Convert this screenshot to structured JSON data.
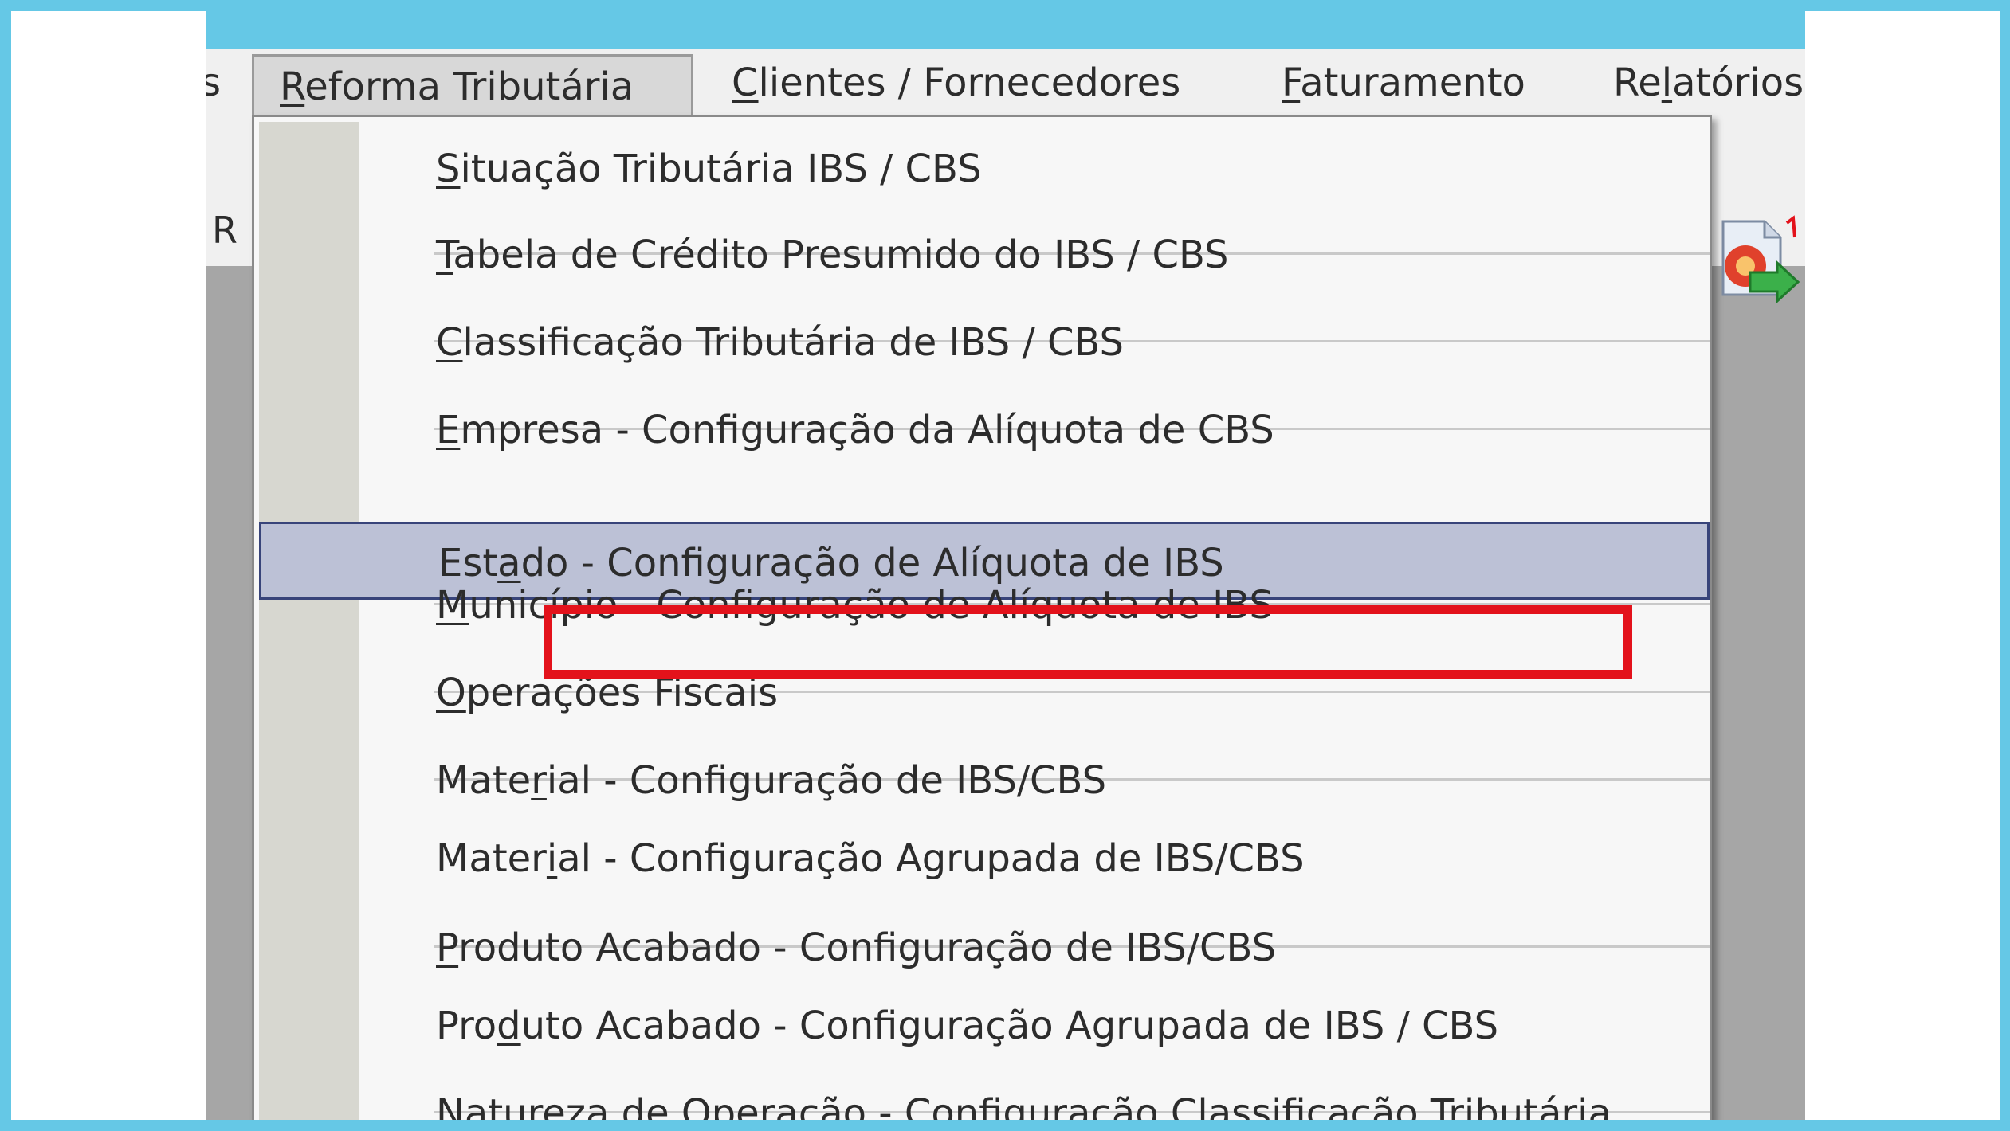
{
  "menubar": {
    "cut_left": "s",
    "items": [
      {
        "acc": "R",
        "rest": "eforma Tributária"
      },
      {
        "acc": "C",
        "rest": "lientes / Fornecedores"
      },
      {
        "acc": "F",
        "rest": "aturamento"
      },
      {
        "pre": "Re",
        "acc": "l",
        "rest": "atórios"
      }
    ]
  },
  "toolbar": {
    "cut_label": "R",
    "icon_name": "export-report-icon"
  },
  "dropdown": {
    "items": [
      {
        "pre": "",
        "acc": "S",
        "rest": "ituação Tributária IBS / CBS"
      },
      {
        "pre": "",
        "acc": "T",
        "rest": "abela de Crédito Presumido do IBS / CBS"
      },
      {
        "pre": "",
        "acc": "C",
        "rest": "lassificação Tributária de IBS / CBS"
      },
      {
        "pre": "",
        "acc": "E",
        "rest": "mpresa - Configuração da Alíquota de CBS"
      },
      {
        "pre": "Est",
        "acc": "a",
        "rest": "do  - Configuração de Alíquota de IBS"
      },
      {
        "pre": "",
        "acc": "M",
        "rest": "unicípio - Configuração de Alíquota de IBS"
      },
      {
        "pre": "",
        "acc": "O",
        "rest": "perações Fiscais"
      },
      {
        "pre": "Mate",
        "acc": "r",
        "rest": "ial - Configuração de IBS/CBS"
      },
      {
        "pre": "Mater",
        "acc": "i",
        "rest": "al - Configuração Agrupada de IBS/CBS"
      },
      {
        "pre": "",
        "acc": "P",
        "rest": "roduto Acabado - Configuração de IBS/CBS"
      },
      {
        "pre": "Pro",
        "acc": "d",
        "rest": "uto Acabado - Configuração Agrupada de IBS / CBS"
      },
      {
        "pre": "",
        "acc": "N",
        "rest": "atureza de Operação - Configuração Classificação Tributária"
      }
    ],
    "highlighted_index": 4,
    "callout_index": 5
  },
  "colors": {
    "frame": "#65c8e6",
    "highlight_bg": "#bcc1d6",
    "highlight_border": "#38447a",
    "callout": "#e3121b"
  }
}
